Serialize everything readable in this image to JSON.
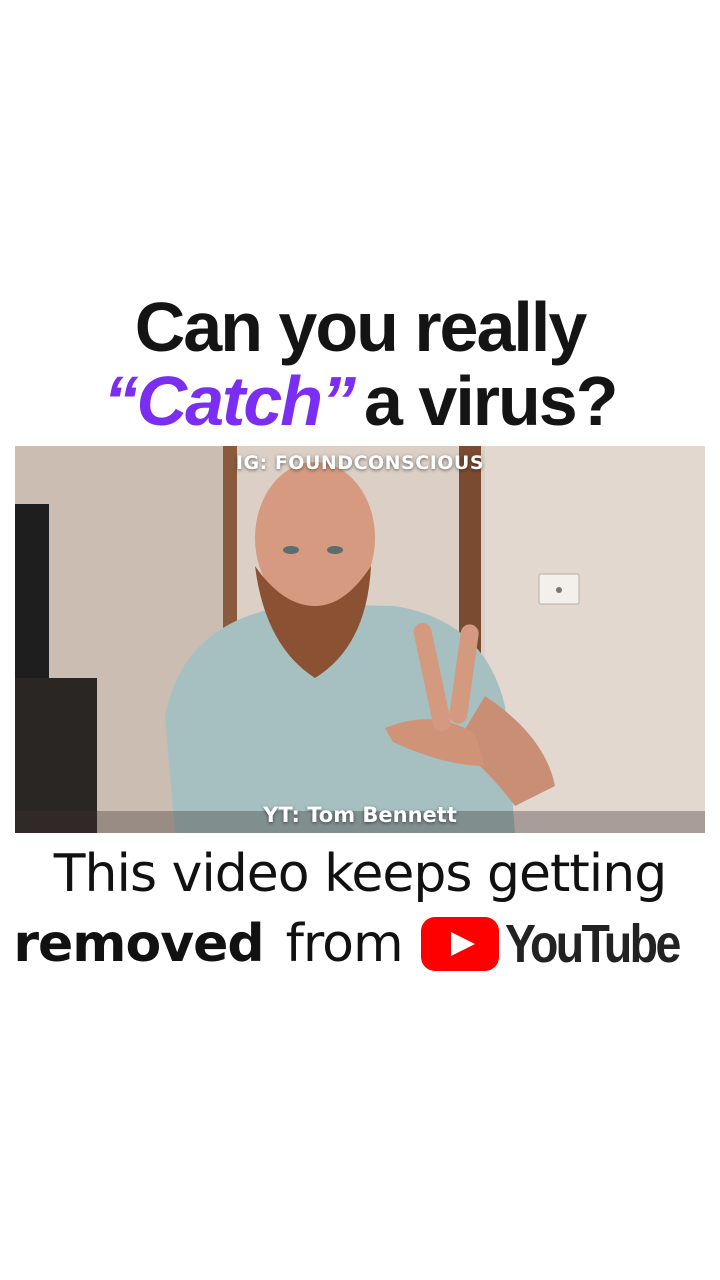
{
  "headline": {
    "line1": "Can you really",
    "catch_word": "“Catch”",
    "line2_rest": "a virus?",
    "accent_color": "#7b2df2"
  },
  "video": {
    "top_overlay": "IG: FOUNDCONSCIOUS",
    "bottom_overlay": "YT: Tom Bennett"
  },
  "caption": {
    "line1": "This video keeps getting",
    "bold_word": "removed",
    "from_word": "from",
    "logo_word": "YouTube",
    "logo_icon": "youtube-play-icon",
    "logo_color": "#ff0000"
  }
}
